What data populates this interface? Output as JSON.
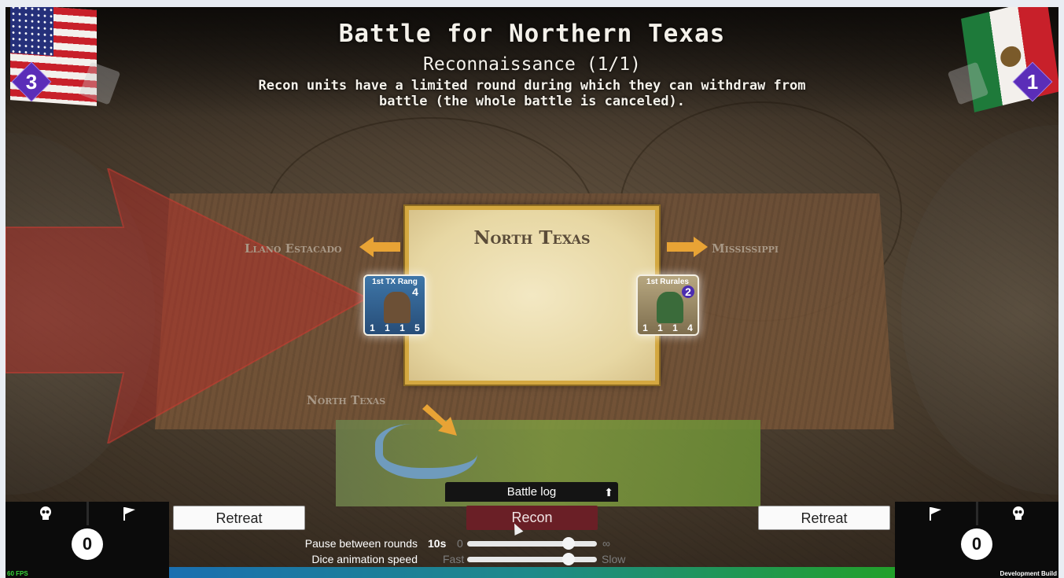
{
  "header": {
    "title": "Battle for Northern Texas",
    "subtitle": "Reconnaissance (1/1)",
    "description_line1": "Recon units have a limited round during which they can withdraw from",
    "description_line2": "battle (the whole battle is canceled)."
  },
  "players": {
    "left": {
      "flag": "us-flag",
      "badge": "3",
      "count": "0"
    },
    "right": {
      "flag": "mexico-flag",
      "badge": "1",
      "count": "0"
    }
  },
  "map": {
    "region_title": "North Texas",
    "adjacent_west": "Llano Estacado",
    "adjacent_east": "Mississippi",
    "adjacent_south": "North Texas"
  },
  "units": {
    "left": {
      "name": "1st TX Rang",
      "strength": "4",
      "stat_a": "1",
      "stat_b": "1",
      "stat_c": "1",
      "stat_d": "5"
    },
    "right": {
      "name": "1st Rurales",
      "strength": "2",
      "stat_a": "1",
      "stat_b": "1",
      "stat_c": "1",
      "stat_d": "4"
    }
  },
  "controls": {
    "retreat_left": "Retreat",
    "retreat_right": "Retreat",
    "recon": "Recon",
    "battle_log": "Battle log",
    "pause_label": "Pause between rounds",
    "pause_value": "10s",
    "pause_min": "0",
    "pause_max": "∞",
    "pause_level": 0.78,
    "dice_label": "Dice animation speed",
    "dice_min": "Fast",
    "dice_max": "Slow",
    "dice_level": 0.78
  },
  "footer": {
    "fps": "60 FPS",
    "build": "Development Build"
  },
  "colors": {
    "accent_purple": "#5b2db8",
    "recon_red": "#6a1f26",
    "arrow_orange": "#e8a335",
    "panel_black": "#0b0b0b"
  }
}
